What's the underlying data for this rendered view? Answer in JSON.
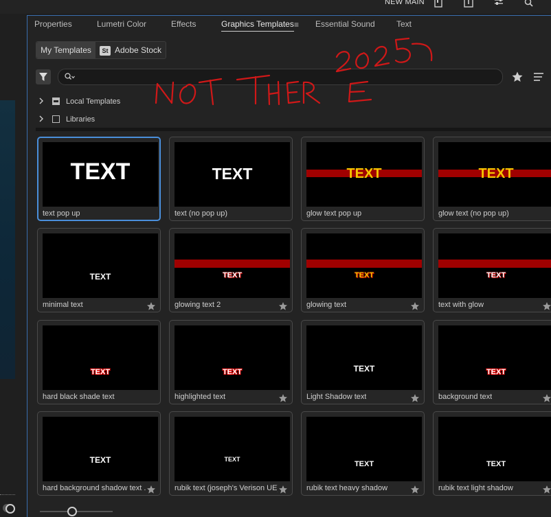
{
  "topbar": {
    "workspace_name": "NEW MAIN"
  },
  "tabs": [
    {
      "label": "Properties"
    },
    {
      "label": "Lumetri Color"
    },
    {
      "label": "Effects"
    },
    {
      "label": "Graphics Templates",
      "active": true
    },
    {
      "label": "Essential Sound"
    },
    {
      "label": "Text"
    }
  ],
  "segmented": {
    "my_templates": "My Templates",
    "adobe_stock": "Adobe Stock",
    "stock_badge": "St"
  },
  "search": {
    "value": "",
    "placeholder": ""
  },
  "tree": [
    {
      "label": "Local Templates",
      "checkbox": "indeterminate"
    },
    {
      "label": "Libraries",
      "checkbox": "unchecked"
    }
  ],
  "annotation": {
    "text": "NOT THERE",
    "year": "2025",
    "color": "#d01818"
  },
  "templates": [
    {
      "name": "text pop up",
      "thumb_text": "TEXT",
      "style": "big-white",
      "selected": true,
      "star": false
    },
    {
      "name": "text (no pop up)",
      "thumb_text": "TEXT",
      "style": "med-white",
      "star": false
    },
    {
      "name": "glow text pop up",
      "thumb_text": "TEXT",
      "style": "yellow-band",
      "star": false
    },
    {
      "name": "glow text (no pop up)",
      "thumb_text": "TEXT",
      "style": "yellow-band",
      "star": false
    },
    {
      "name": "minimal text",
      "thumb_text": "TEXT",
      "style": "small-white",
      "star": true
    },
    {
      "name": "glowing text 2",
      "thumb_text": "TEXT",
      "style": "band-white",
      "star": true
    },
    {
      "name": "glowing text",
      "thumb_text": "TEXT",
      "style": "band-yellow",
      "star": true
    },
    {
      "name": "text with glow",
      "thumb_text": "TEXT",
      "style": "band-white",
      "star": true
    },
    {
      "name": "hard black shade text",
      "thumb_text": "TEXT",
      "style": "red-shadow",
      "star": false
    },
    {
      "name": "highlighted text",
      "thumb_text": "TEXT",
      "style": "red-shadow",
      "star": true
    },
    {
      "name": "Light Shadow text",
      "thumb_text": "TEXT",
      "style": "small-white",
      "star": true
    },
    {
      "name": "background text",
      "thumb_text": "TEXT",
      "style": "red-shadow",
      "star": true
    },
    {
      "name": "hard background shadow text ...",
      "thumb_text": "TEXT",
      "style": "small-white",
      "star": true
    },
    {
      "name": "rubik text (joseph's Verison UE)",
      "thumb_text": "TEXT",
      "style": "tiny-white",
      "star": true
    },
    {
      "name": "rubik text heavy shadow",
      "thumb_text": "TEXT",
      "style": "small-white-low",
      "star": true
    },
    {
      "name": "rubik text light shadow",
      "thumb_text": "TEXT",
      "style": "small-white-low",
      "star": true
    }
  ],
  "colors": {
    "accent": "#4a8fdb",
    "band": "#a00000",
    "yellow": "#f5c400"
  }
}
